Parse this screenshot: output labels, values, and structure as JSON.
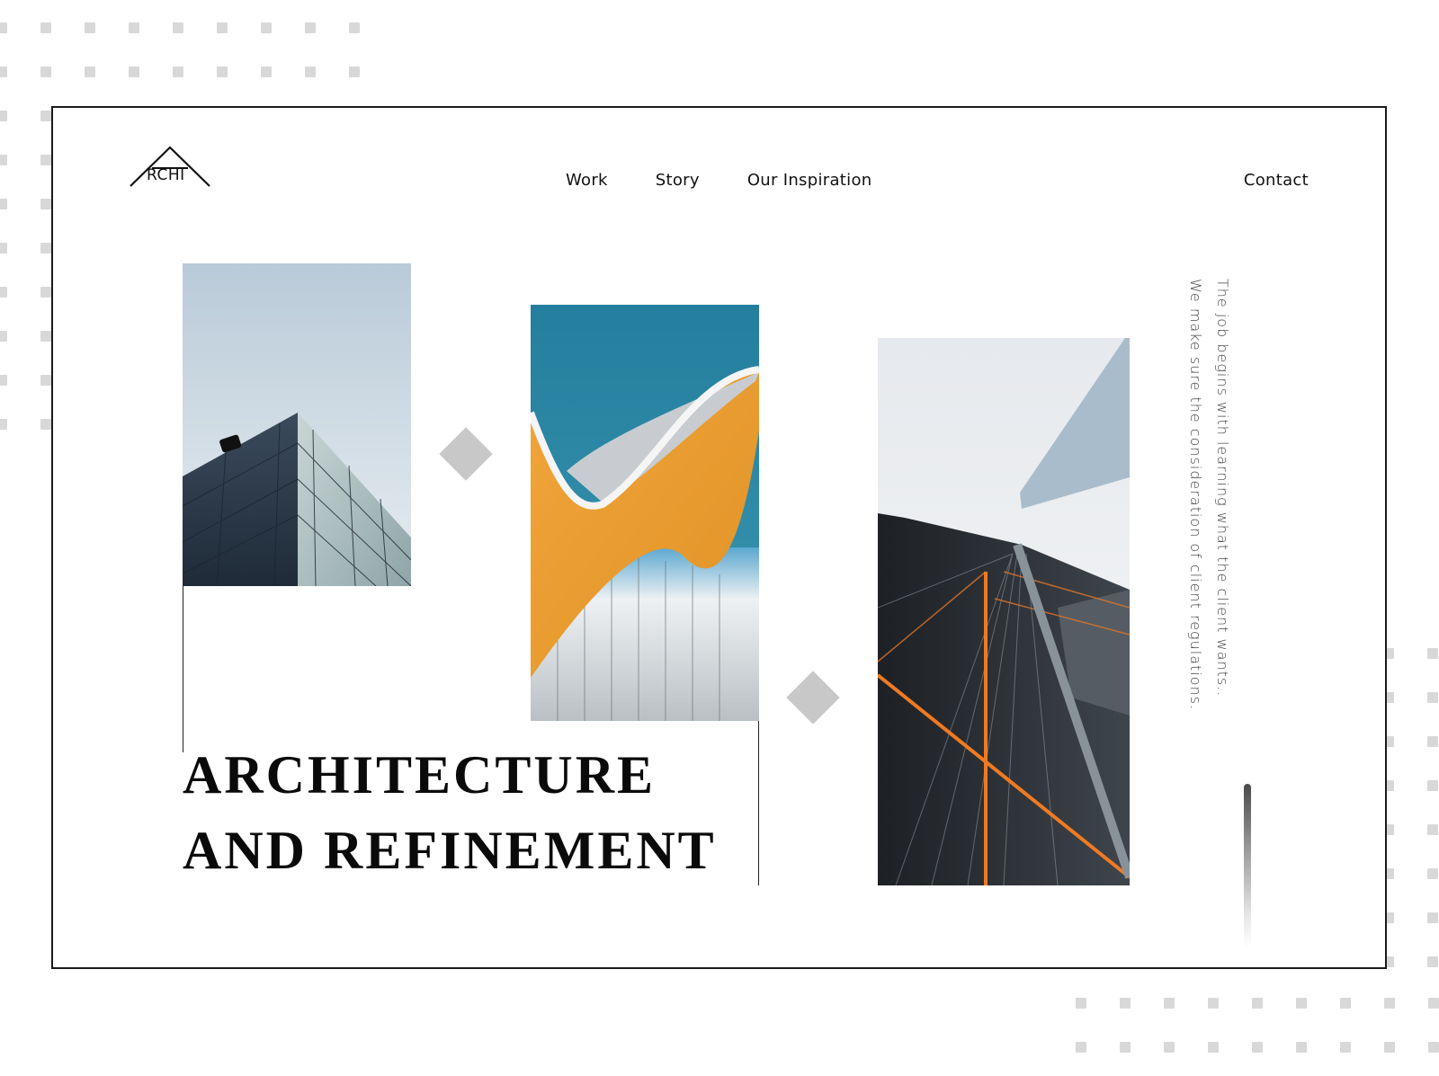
{
  "brand": {
    "logo_text": "RCHI",
    "logo_name": "ARCHI"
  },
  "nav": {
    "items": [
      {
        "label": "Work"
      },
      {
        "label": "Story"
      },
      {
        "label": "Our Inspiration"
      }
    ],
    "contact_label": "Contact"
  },
  "hero": {
    "headline_line1": "ARCHITECTURE",
    "headline_line2": "AND REFINEMENT"
  },
  "side_text": {
    "line1": "The job begins with learning what the client wants..",
    "line2": "We make sure the consideration of client regulations."
  },
  "images": [
    {
      "subject": "modern building corner against cloudy sky"
    },
    {
      "subject": "orange wavy facade with glass curtain wall"
    },
    {
      "subject": "skyscrapers from below with orange light streaks"
    }
  ],
  "colors": {
    "frame_border": "#1a1a1a",
    "diamond": "#c8c8c8",
    "dot_pattern": "#d8d8d8",
    "text": "#111111"
  }
}
